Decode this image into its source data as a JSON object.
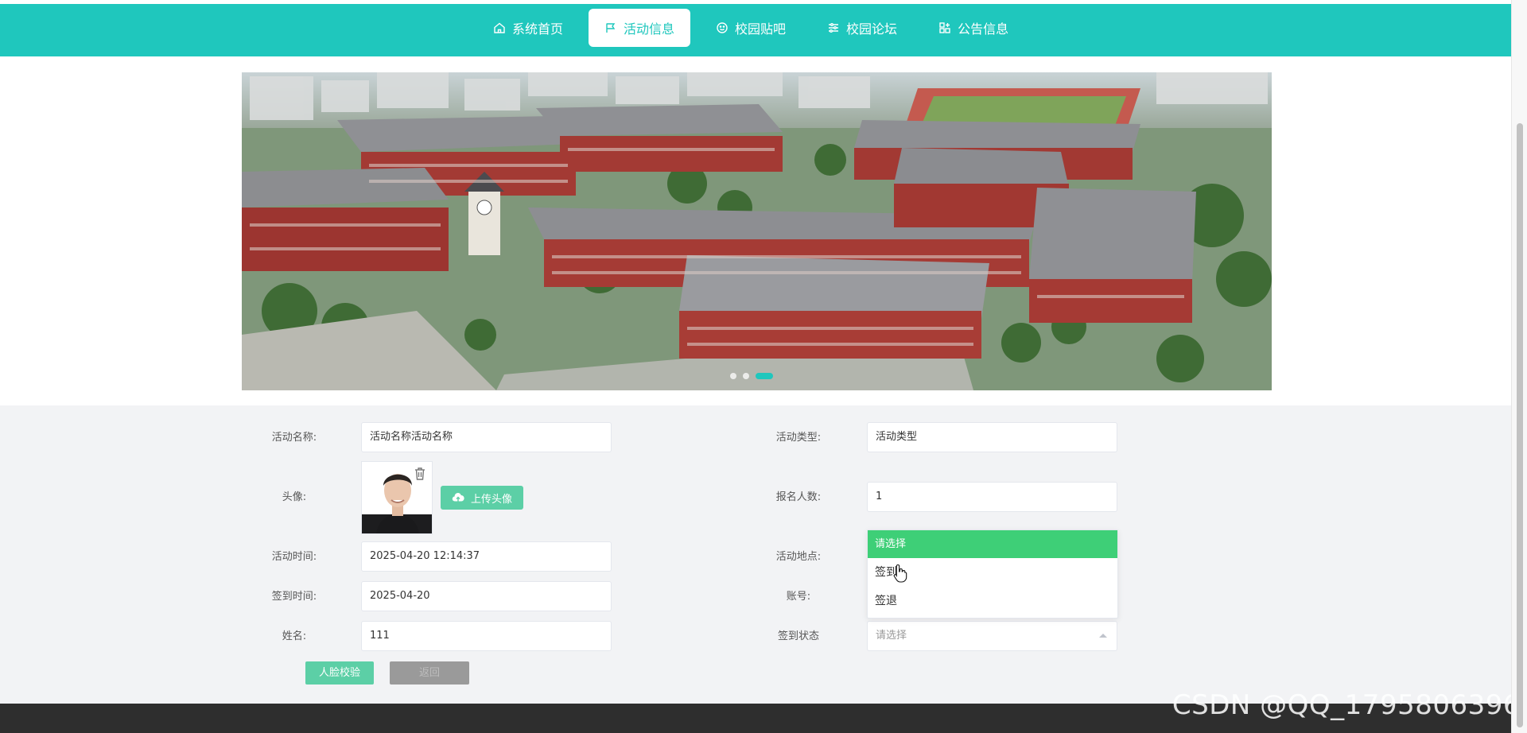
{
  "nav": {
    "items": [
      {
        "label": "系统首页",
        "icon": "home-icon",
        "active": false
      },
      {
        "label": "活动信息",
        "icon": "flag-icon",
        "active": true
      },
      {
        "label": "校园贴吧",
        "icon": "smile-icon",
        "active": false
      },
      {
        "label": "校园论坛",
        "icon": "sliders-icon",
        "active": false
      },
      {
        "label": "公告信息",
        "icon": "grid-plus-icon",
        "active": false
      }
    ]
  },
  "banner": {
    "dots_count": 3,
    "active_dot": 3
  },
  "form": {
    "activity_name": {
      "label": "活动名称:",
      "value": "活动名称活动名称"
    },
    "activity_type": {
      "label": "活动类型:",
      "value": "活动类型"
    },
    "avatar": {
      "label": "头像:",
      "upload_label": "上传头像"
    },
    "signup_count": {
      "label": "报名人数:",
      "value": "1"
    },
    "activity_time": {
      "label": "活动时间:",
      "value": "2025-04-20 12:14:37"
    },
    "activity_location": {
      "label": "活动地点:"
    },
    "checkin_time": {
      "label": "签到时间:",
      "value": "2025-04-20"
    },
    "account": {
      "label": "账号:"
    },
    "name": {
      "label": "姓名:",
      "value": "111"
    },
    "checkin_status": {
      "label": "签到状态",
      "placeholder": "请选择"
    },
    "dropdown": {
      "header": "请选择",
      "options": [
        "签到",
        "签退"
      ]
    }
  },
  "buttons": {
    "face_verify": "人脸校验",
    "back": "返回"
  },
  "watermark": "CSDN @QQ_1795806396",
  "colors": {
    "primary": "#1fc7bd",
    "button_green": "#5ccfa6",
    "dropdown_header": "#3ecf77",
    "footer": "#2e2e2e"
  }
}
